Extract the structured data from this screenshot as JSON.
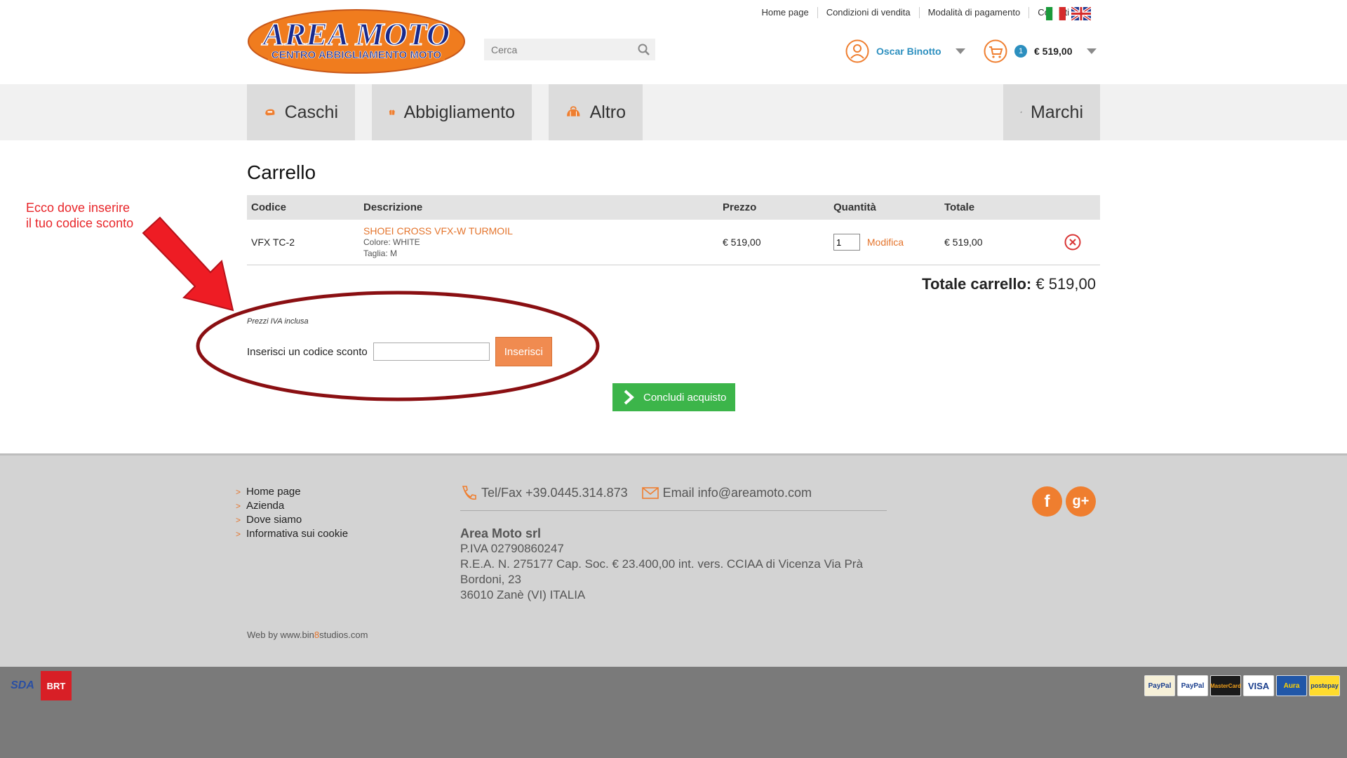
{
  "header": {
    "logo": {
      "title": "AREA MOTO",
      "subtitle": "CENTRO ABBIGLIAMENTO MOTO"
    },
    "search": {
      "placeholder": "Cerca",
      "value": ""
    },
    "topnav": [
      "Home page",
      "Condizioni di vendita",
      "Modalità di pagamento",
      "Contatti"
    ],
    "user": {
      "name": "Oscar Binotto"
    },
    "mini_cart": {
      "count": "1",
      "total": "€ 519,00"
    }
  },
  "categories": [
    {
      "label": "Caschi",
      "icon": "helmet-icon"
    },
    {
      "label": "Abbigliamento",
      "icon": "jacket-icon"
    },
    {
      "label": "Altro",
      "icon": "bag-icon"
    },
    {
      "label": "Marchi",
      "icon": "tag-icon"
    }
  ],
  "cart": {
    "title": "Carrello",
    "columns": [
      "Codice",
      "Descrizione",
      "Prezzo",
      "Quantità",
      "Totale"
    ],
    "rows": [
      {
        "code": "VFX TC-2",
        "product": "SHOEI CROSS VFX-W TURMOIL",
        "color": "Colore: WHITE",
        "size": "Taglia: M",
        "price": "€ 519,00",
        "quantity": "1",
        "modify_label": "Modifica",
        "total": "€ 519,00"
      }
    ],
    "total_label": "Totale carrello:",
    "total_value": "€ 519,00",
    "vat_note": "Prezzi IVA inclusa",
    "coupon_label": "Inserisci un codice sconto",
    "coupon_value": "",
    "coupon_button": "Inserisci",
    "checkout_button": "Concludi acquisto"
  },
  "annotation": {
    "line1": "Ecco dove inserire",
    "line2": "il tuo codice sconto",
    "color": "#e8262a"
  },
  "footer": {
    "links": [
      "Home page",
      "Azienda",
      "Dove siamo",
      "Informativa sui cookie"
    ],
    "phone": "Tel/Fax +39.0445.314.873",
    "email": "Email info@areamoto.com",
    "company_name": "Area Moto srl",
    "vat": "P.IVA 02790860247",
    "rea": "R.E.A. N. 275177 Cap. Soc. € 23.400,00 int. vers. CCIAA di Vicenza Via Prà Bordoni, 23",
    "address": "36010 Zanè (VI) ITALIA",
    "webby_prefix": "Web by www.bin",
    "webby_accent": "8",
    "webby_suffix": "studios.com",
    "social": [
      "f",
      "g+"
    ]
  },
  "bottombar": {
    "couriers": [
      "SDA",
      "BRT"
    ],
    "payments": [
      "PayPal",
      "PayPal",
      "MasterCard",
      "VISA",
      "Aura",
      "postepay"
    ]
  },
  "colors": {
    "accent_orange": "#e4742c",
    "link_blue": "#2c8fbf",
    "checkout_green": "#3cb54a",
    "annotation_red": "#e8262a"
  }
}
